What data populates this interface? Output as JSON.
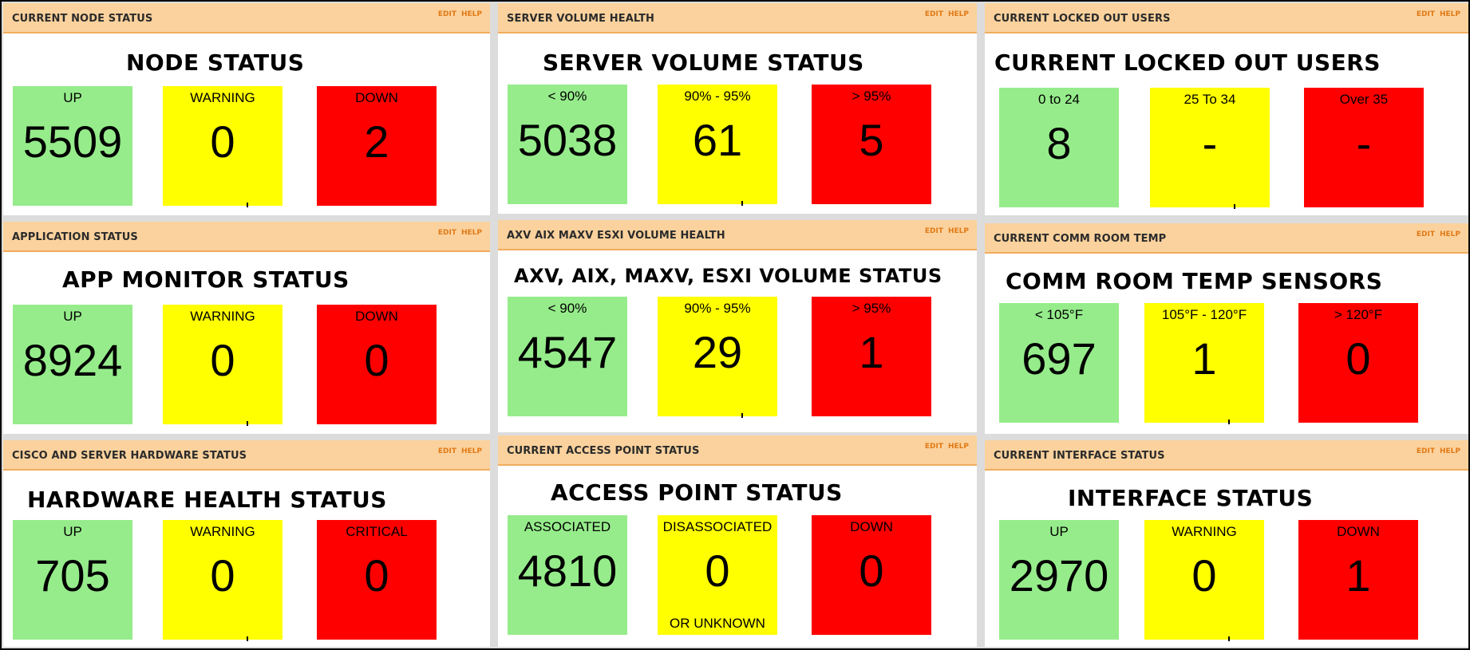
{
  "header_links": {
    "edit": "EDIT",
    "help": "HELP"
  },
  "panels": [
    {
      "header": "CURRENT NODE STATUS",
      "title": "NODE STATUS",
      "boxes": [
        {
          "label": "UP",
          "value": "5509",
          "color": "#96ec8b"
        },
        {
          "label": "WARNING",
          "value": "0",
          "color": "#ffff00"
        },
        {
          "label": "DOWN",
          "value": "2",
          "color": "#ff0000"
        }
      ]
    },
    {
      "header": "SERVER VOLUME HEALTH",
      "title": "SERVER VOLUME STATUS",
      "boxes": [
        {
          "label": "< 90%",
          "value": "5038",
          "color": "#96ec8b"
        },
        {
          "label": "90% - 95%",
          "value": "61",
          "color": "#ffff00"
        },
        {
          "label": "> 95%",
          "value": "5",
          "color": "#ff0000"
        }
      ]
    },
    {
      "header": "CURRENT LOCKED OUT USERS",
      "title": "CURRENT LOCKED OUT USERS",
      "boxes": [
        {
          "label": "0 to 24",
          "value": "8",
          "color": "#96ec8b"
        },
        {
          "label": "25 To 34",
          "value": "-",
          "color": "#ffff00"
        },
        {
          "label": "Over 35",
          "value": "-",
          "color": "#ff0000"
        }
      ]
    },
    {
      "header": "APPLICATION STATUS",
      "title": "APP MONITOR STATUS",
      "boxes": [
        {
          "label": "UP",
          "value": "8924",
          "color": "#96ec8b"
        },
        {
          "label": "WARNING",
          "value": "0",
          "color": "#ffff00"
        },
        {
          "label": "DOWN",
          "value": "0",
          "color": "#ff0000"
        }
      ]
    },
    {
      "header": "AXV AIX MAXV ESXI VOLUME HEALTH",
      "title": "AXV, AIX, MAXV, ESXI VOLUME STATUS",
      "boxes": [
        {
          "label": "< 90%",
          "value": "4547",
          "color": "#96ec8b"
        },
        {
          "label": "90% - 95%",
          "value": "29",
          "color": "#ffff00"
        },
        {
          "label": "> 95%",
          "value": "1",
          "color": "#ff0000"
        }
      ]
    },
    {
      "header": "CURRENT COMM ROOM TEMP",
      "title": "COMM ROOM TEMP SENSORS",
      "boxes": [
        {
          "label": "< 105°F",
          "value": "697",
          "color": "#96ec8b"
        },
        {
          "label": "105°F - 120°F",
          "value": "1",
          "color": "#ffff00"
        },
        {
          "label": "> 120°F",
          "value": "0",
          "color": "#ff0000"
        }
      ]
    },
    {
      "header": "CISCO AND SERVER HARDWARE STATUS",
      "title": "HARDWARE HEALTH STATUS",
      "boxes": [
        {
          "label": "UP",
          "value": "705",
          "color": "#96ec8b"
        },
        {
          "label": "WARNING",
          "value": "0",
          "color": "#ffff00"
        },
        {
          "label": "CRITICAL",
          "value": "0",
          "color": "#ff0000"
        }
      ]
    },
    {
      "header": "CURRENT ACCESS POINT STATUS",
      "title": "ACCESS POINT STATUS",
      "boxes": [
        {
          "label": "ASSOCIATED",
          "value": "4810",
          "color": "#96ec8b"
        },
        {
          "label": "DISASSOCIATED",
          "value": "0",
          "sub": "OR UNKNOWN",
          "color": "#ffff00"
        },
        {
          "label": "DOWN",
          "value": "0",
          "color": "#ff0000"
        }
      ]
    },
    {
      "header": "CURRENT INTERFACE STATUS",
      "title": "INTERFACE STATUS",
      "boxes": [
        {
          "label": "UP",
          "value": "2970",
          "color": "#96ec8b"
        },
        {
          "label": "WARNING",
          "value": "0",
          "color": "#ffff00"
        },
        {
          "label": "DOWN",
          "value": "1",
          "color": "#ff0000"
        }
      ]
    }
  ]
}
